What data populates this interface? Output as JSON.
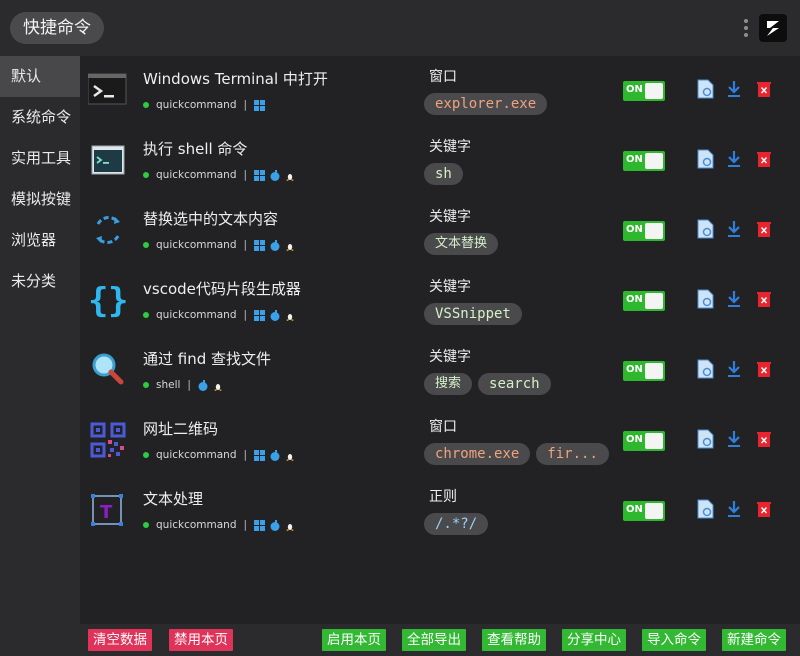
{
  "header": {
    "title": "快捷命令"
  },
  "sidebar": {
    "items": [
      {
        "label": "默认"
      },
      {
        "label": "系统命令"
      },
      {
        "label": "实用工具"
      },
      {
        "label": "模拟按键"
      },
      {
        "label": "浏览器"
      },
      {
        "label": "未分类"
      }
    ]
  },
  "commands": [
    {
      "title": "Windows Terminal 中打开",
      "author": "quickcommand",
      "separator": "|",
      "type": "窗口",
      "chips": [
        "explorer.exe"
      ],
      "toggle": "ON",
      "icon": "terminal-icon"
    },
    {
      "title": "执行 shell 命令",
      "author": "quickcommand",
      "separator": "|",
      "type": "关键字",
      "chips": [
        "sh"
      ],
      "toggle": "ON",
      "icon": "shell-icon"
    },
    {
      "title": "替换选中的文本内容",
      "author": "quickcommand",
      "separator": "|",
      "type": "关键字",
      "chips": [
        "文本替换"
      ],
      "toggle": "ON",
      "icon": "replace-icon"
    },
    {
      "title": "vscode代码片段生成器",
      "author": "quickcommand",
      "separator": "|",
      "type": "关键字",
      "chips": [
        "VSSnippet"
      ],
      "toggle": "ON",
      "icon": "braces-icon"
    },
    {
      "title": "通过 find 查找文件",
      "author": "shell",
      "separator": "|",
      "type": "关键字",
      "chips": [
        "搜索",
        "search"
      ],
      "toggle": "ON",
      "icon": "magnifier-icon"
    },
    {
      "title": "网址二维码",
      "author": "quickcommand",
      "separator": "|",
      "type": "窗口",
      "chips": [
        "chrome.exe",
        "fir..."
      ],
      "toggle": "ON",
      "icon": "qrcode-icon"
    },
    {
      "title": "文本处理",
      "author": "quickcommand",
      "separator": "|",
      "type": "正则",
      "chips": [
        "/.*?/"
      ],
      "toggle": "ON",
      "icon": "text-tool-icon"
    }
  ],
  "footer": {
    "clear": "清空数据",
    "disable": "禁用本页",
    "enable": "启用本页",
    "export_all": "全部导出",
    "help": "查看帮助",
    "share": "分享中心",
    "import": "导入命令",
    "new": "新建命令"
  },
  "colors": {
    "accent_green": "#33b833",
    "danger_red": "#e0335a",
    "chip_bg": "#4a4a4d"
  }
}
